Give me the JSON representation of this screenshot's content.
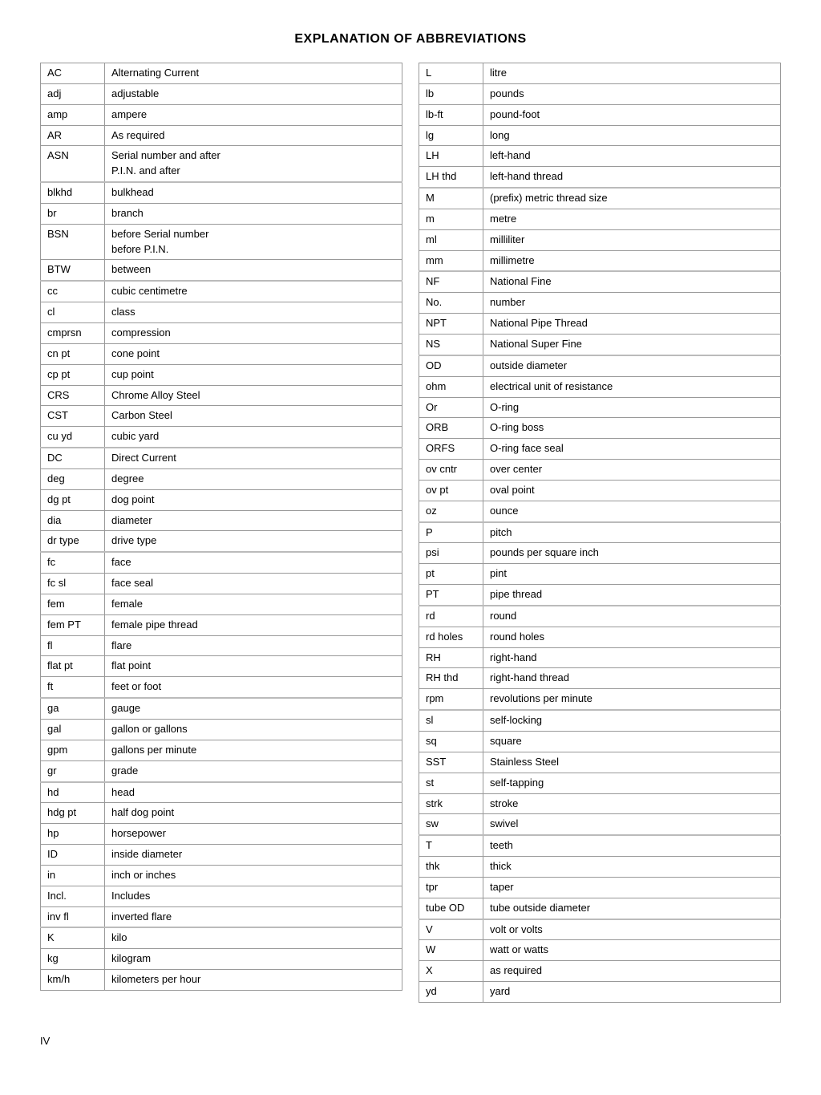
{
  "title": "EXPLANATION OF ABBREVIATIONS",
  "left_table": [
    {
      "abbr": "AC",
      "def": "Alternating Current",
      "section_start": false
    },
    {
      "abbr": "adj",
      "def": "adjustable",
      "section_start": false
    },
    {
      "abbr": "amp",
      "def": "ampere",
      "section_start": false
    },
    {
      "abbr": "AR",
      "def": "As required",
      "section_start": false
    },
    {
      "abbr": "ASN",
      "def": "Serial number and after\nP.I.N. and after",
      "section_start": false
    },
    {
      "abbr": "blkhd",
      "def": "bulkhead",
      "section_start": true
    },
    {
      "abbr": "br",
      "def": "branch",
      "section_start": false
    },
    {
      "abbr": "BSN",
      "def": "before Serial number\nbefore P.I.N.",
      "section_start": false
    },
    {
      "abbr": "BTW",
      "def": "between",
      "section_start": false
    },
    {
      "abbr": "cc",
      "def": "cubic centimetre",
      "section_start": true
    },
    {
      "abbr": "cl",
      "def": "class",
      "section_start": false
    },
    {
      "abbr": "cmprsn",
      "def": "compression",
      "section_start": false
    },
    {
      "abbr": "cn pt",
      "def": "cone point",
      "section_start": false
    },
    {
      "abbr": "cp pt",
      "def": "cup point",
      "section_start": false
    },
    {
      "abbr": "CRS",
      "def": "Chrome Alloy Steel",
      "section_start": false
    },
    {
      "abbr": "CST",
      "def": "Carbon Steel",
      "section_start": false
    },
    {
      "abbr": "cu yd",
      "def": "cubic yard",
      "section_start": false
    },
    {
      "abbr": "DC",
      "def": "Direct Current",
      "section_start": true
    },
    {
      "abbr": "deg",
      "def": "degree",
      "section_start": false
    },
    {
      "abbr": "dg pt",
      "def": "dog point",
      "section_start": false
    },
    {
      "abbr": "dia",
      "def": "diameter",
      "section_start": false
    },
    {
      "abbr": "dr type",
      "def": "drive type",
      "section_start": false
    },
    {
      "abbr": "fc",
      "def": "face",
      "section_start": true
    },
    {
      "abbr": "fc sl",
      "def": "face seal",
      "section_start": false
    },
    {
      "abbr": "fem",
      "def": "female",
      "section_start": false
    },
    {
      "abbr": "fem PT",
      "def": "female pipe thread",
      "section_start": false
    },
    {
      "abbr": "fl",
      "def": "flare",
      "section_start": false
    },
    {
      "abbr": "flat pt",
      "def": "flat point",
      "section_start": false
    },
    {
      "abbr": "ft",
      "def": "feet or foot",
      "section_start": false
    },
    {
      "abbr": "ga",
      "def": "gauge",
      "section_start": true
    },
    {
      "abbr": "gal",
      "def": "gallon or gallons",
      "section_start": false
    },
    {
      "abbr": "gpm",
      "def": "gallons per minute",
      "section_start": false
    },
    {
      "abbr": "gr",
      "def": "grade",
      "section_start": false
    },
    {
      "abbr": "hd",
      "def": "head",
      "section_start": true
    },
    {
      "abbr": "hdg pt",
      "def": "half dog point",
      "section_start": false
    },
    {
      "abbr": "hp",
      "def": "horsepower",
      "section_start": false
    },
    {
      "abbr": "ID",
      "def": "inside diameter",
      "section_start": false
    },
    {
      "abbr": "in",
      "def": "inch or inches",
      "section_start": false
    },
    {
      "abbr": "Incl.",
      "def": "Includes",
      "section_start": false
    },
    {
      "abbr": "inv fl",
      "def": "inverted flare",
      "section_start": false
    },
    {
      "abbr": "K",
      "def": "kilo",
      "section_start": true
    },
    {
      "abbr": "kg",
      "def": "kilogram",
      "section_start": false
    },
    {
      "abbr": "km/h",
      "def": "kilometers per hour",
      "section_start": false
    }
  ],
  "right_table": [
    {
      "abbr": "L",
      "def": "litre",
      "section_start": false
    },
    {
      "abbr": "lb",
      "def": "pounds",
      "section_start": false
    },
    {
      "abbr": "lb-ft",
      "def": "pound-foot",
      "section_start": false
    },
    {
      "abbr": "lg",
      "def": "long",
      "section_start": false
    },
    {
      "abbr": "LH",
      "def": "left-hand",
      "section_start": false
    },
    {
      "abbr": "LH thd",
      "def": "left-hand thread",
      "section_start": false
    },
    {
      "abbr": "M",
      "def": "(prefix) metric thread size",
      "section_start": true
    },
    {
      "abbr": "m",
      "def": "metre",
      "section_start": false
    },
    {
      "abbr": "ml",
      "def": "milliliter",
      "section_start": false
    },
    {
      "abbr": "mm",
      "def": "millimetre",
      "section_start": false
    },
    {
      "abbr": "NF",
      "def": "National Fine",
      "section_start": true
    },
    {
      "abbr": "No.",
      "def": "number",
      "section_start": false
    },
    {
      "abbr": "NPT",
      "def": "National Pipe Thread",
      "section_start": false
    },
    {
      "abbr": "NS",
      "def": "National Super Fine",
      "section_start": false
    },
    {
      "abbr": "OD",
      "def": "outside diameter",
      "section_start": true
    },
    {
      "abbr": "ohm",
      "def": "electrical unit of resistance",
      "section_start": false
    },
    {
      "abbr": "Or",
      "def": "O-ring",
      "section_start": false
    },
    {
      "abbr": "ORB",
      "def": "O-ring boss",
      "section_start": false
    },
    {
      "abbr": "ORFS",
      "def": "O-ring face seal",
      "section_start": false
    },
    {
      "abbr": "ov cntr",
      "def": "over center",
      "section_start": false
    },
    {
      "abbr": "ov pt",
      "def": "oval point",
      "section_start": false
    },
    {
      "abbr": "oz",
      "def": "ounce",
      "section_start": false
    },
    {
      "abbr": "P",
      "def": "pitch",
      "section_start": true
    },
    {
      "abbr": "psi",
      "def": "pounds per square inch",
      "section_start": false
    },
    {
      "abbr": "pt",
      "def": "pint",
      "section_start": false
    },
    {
      "abbr": "PT",
      "def": "pipe thread",
      "section_start": false
    },
    {
      "abbr": "rd",
      "def": "round",
      "section_start": true
    },
    {
      "abbr": "rd holes",
      "def": "round holes",
      "section_start": false
    },
    {
      "abbr": "RH",
      "def": "right-hand",
      "section_start": false
    },
    {
      "abbr": "RH thd",
      "def": "right-hand thread",
      "section_start": false
    },
    {
      "abbr": "rpm",
      "def": "revolutions per minute",
      "section_start": false
    },
    {
      "abbr": "sl",
      "def": "self-locking",
      "section_start": true
    },
    {
      "abbr": "sq",
      "def": "square",
      "section_start": false
    },
    {
      "abbr": "SST",
      "def": "Stainless Steel",
      "section_start": false
    },
    {
      "abbr": "st",
      "def": "self-tapping",
      "section_start": false
    },
    {
      "abbr": "strk",
      "def": "stroke",
      "section_start": false
    },
    {
      "abbr": "sw",
      "def": "swivel",
      "section_start": false
    },
    {
      "abbr": "T",
      "def": "teeth",
      "section_start": true
    },
    {
      "abbr": "thk",
      "def": "thick",
      "section_start": false
    },
    {
      "abbr": "tpr",
      "def": "taper",
      "section_start": false
    },
    {
      "abbr": "tube OD",
      "def": "tube outside diameter",
      "section_start": false
    },
    {
      "abbr": "V",
      "def": "volt or volts",
      "section_start": true
    },
    {
      "abbr": "W",
      "def": "watt or watts",
      "section_start": false
    },
    {
      "abbr": "X",
      "def": "as required",
      "section_start": false
    },
    {
      "abbr": "yd",
      "def": "yard",
      "section_start": false
    }
  ],
  "page_number": "IV"
}
